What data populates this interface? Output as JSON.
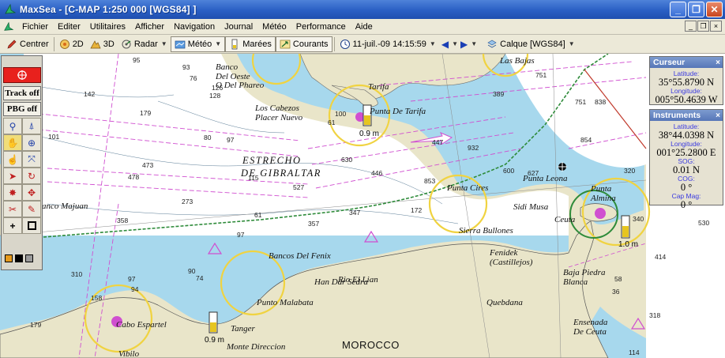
{
  "window": {
    "title": "MaxSea - [C-MAP  1:250 000 [WGS84] ]",
    "min_glyph": "_",
    "restore_glyph": "❐",
    "close_glyph": "✕"
  },
  "menu": {
    "items": [
      "Fichier",
      "Editer",
      "Utilitaires",
      "Afficher",
      "Navigation",
      "Journal",
      "Météo",
      "Performance",
      "Aide"
    ],
    "mdi_min": "_",
    "mdi_restore": "❐",
    "mdi_close": "×"
  },
  "toolbar": {
    "center_label": "Centrer",
    "view2d_label": "2D",
    "view3d_label": "3D",
    "radar_label": "Radar",
    "meteo_label": "Météo",
    "marees_label": "Marées",
    "courants_label": "Courants",
    "datetime": "11-juil.-09 14:15:59",
    "calque_label": "Calque [WGS84]"
  },
  "palette": {
    "track_label": "Track off",
    "pbg_label": "PBG off",
    "plus_glyph": "+"
  },
  "cursor_panel": {
    "title": "Curseur",
    "close": "×",
    "lat_label": "Latitude:",
    "lat_value": "35°55.8790 N",
    "lon_label": "Longitude:",
    "lon_value": "005°50.4639 W"
  },
  "instruments_panel": {
    "title": "Instruments",
    "close": "×",
    "lat_label": "Latitude:",
    "lat_value": "38°44.0398 N",
    "lon_label": "Longitude:",
    "lon_value": "001°25.2800 E",
    "sog_label": "SOG:",
    "sog_value": "0.01 N",
    "cog_label": "COG:",
    "cog_value": "0 °",
    "cap_label": "Cap Mag:",
    "cap_value": "0 °"
  },
  "map": {
    "places": {
      "banco_oeste": "Banco\nDel Oeste\nO Del Phareo",
      "cabezos": "Los Cabezos\nPlacer Nuevo",
      "tarifa_punta": "Punta De Tarifa",
      "tarifa": "Tarifa",
      "las_bajas": "Las Bajas",
      "estrecho1": "ESTRECHO",
      "estrecho2": "DE GIBRALTAR",
      "punta_cires": "Punta Cires",
      "punta_leona": "Punta Leona",
      "punta_almina": "Punta\nAlmina",
      "sidi_musa": "Sidi Musa",
      "ceuta": "Ceuta",
      "sierra_bullones": "Sierra Bullones",
      "fenidek": "Fenidek\n(Castillejos)",
      "bancos_fenix": "Bancos Del Fenix",
      "han_dar": "Han Dar Sedra",
      "rio_lian": "Rio El Lian",
      "punto_malabata": "Punto Malabata",
      "tanger": "Tanger",
      "monte_direccion": "Monte Direccion",
      "morocco": "MOROCCO",
      "quebdana": "Quebdana",
      "baja_piedra": "Baja Piedra\nBlanca",
      "ensenada": "Ensenada\nDe Ceuta",
      "cabo_espartel": "Cabo Espartel",
      "vibilo": "Vibilo",
      "banco_majuan": "anco Majuan"
    },
    "gauges": {
      "tarifa": "0.9 m",
      "tanger": "0.9 m",
      "ceuta": "1.0 m"
    },
    "depths": [
      "95",
      "93",
      "76",
      "142",
      "179",
      "101",
      "128",
      "80",
      "97",
      "473",
      "478",
      "273",
      "358",
      "310",
      "97",
      "94",
      "179",
      "158",
      "126",
      "61",
      "100",
      "630",
      "932",
      "600",
      "627",
      "854",
      "320",
      "340",
      "530",
      "414",
      "838",
      "389",
      "751",
      "751",
      "347",
      "357",
      "172",
      "853",
      "446",
      "447",
      "527",
      "115",
      "61",
      "97",
      "318",
      "114",
      "90",
      "74",
      "58",
      "36"
    ]
  },
  "colors": {
    "water": "#a7d8ed",
    "deep": "#ffffff",
    "land": "#e9e5c9",
    "track": "#2e8b3a",
    "tide_ring": "#f0d341",
    "title_blue": "#2a5fc4"
  }
}
